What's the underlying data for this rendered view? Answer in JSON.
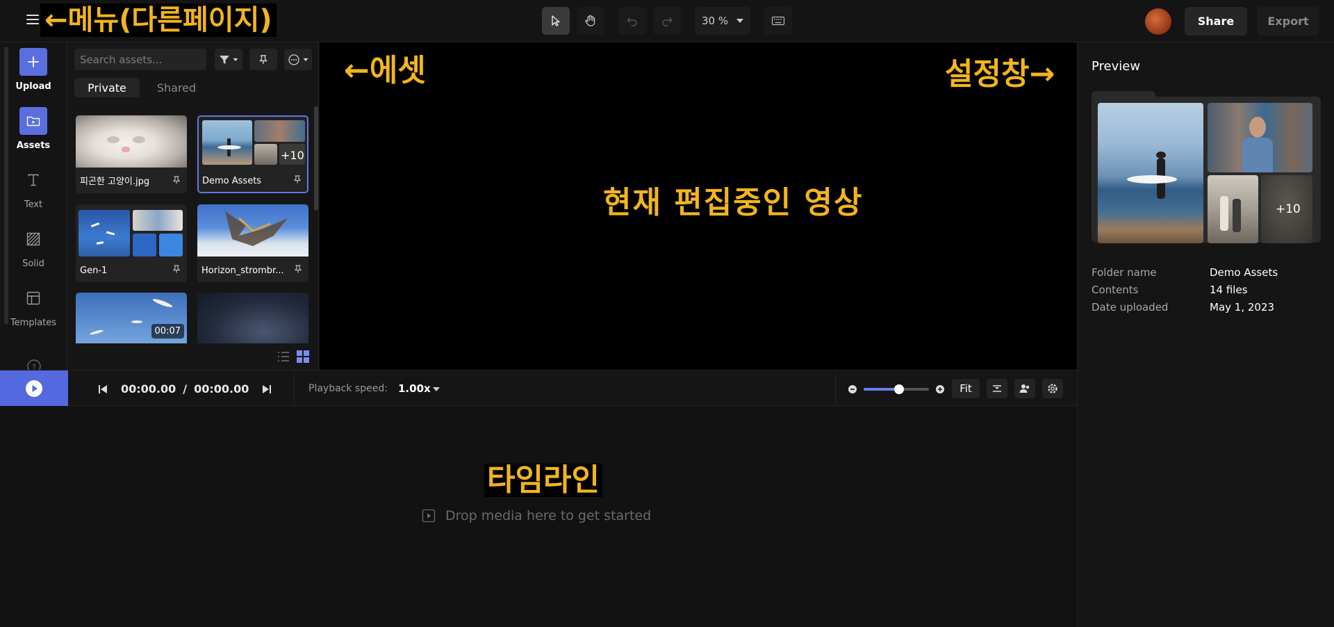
{
  "topbar": {
    "menu_annotation": "←메뉴(다른페이지)",
    "zoom_value": "30 %",
    "share_label": "Share",
    "export_label": "Export"
  },
  "rail": {
    "items": [
      {
        "label": "Upload",
        "icon": "plus-icon"
      },
      {
        "label": "Assets",
        "icon": "folder-play-icon"
      },
      {
        "label": "Text",
        "icon": "text-icon"
      },
      {
        "label": "Solid",
        "icon": "hatched-square-icon"
      },
      {
        "label": "Templates",
        "icon": "layout-icon"
      }
    ]
  },
  "assets": {
    "search_placeholder": "Search assets...",
    "tabs": [
      "Private",
      "Shared"
    ],
    "cards": [
      {
        "name": "피곤한 고양이.jpg"
      },
      {
        "name": "Demo Assets",
        "badge": "+10"
      },
      {
        "name": "Gen-1"
      },
      {
        "name": "Horizon_strombr..."
      },
      {
        "badge": "00:07"
      },
      {}
    ]
  },
  "canvas": {
    "asset_annotation": "←에셋",
    "settings_annotation": "설정창→",
    "video_annotation": "현재 편집중인 영상"
  },
  "preview": {
    "title": "Preview",
    "badge": "+10",
    "meta": [
      {
        "key": "Folder name",
        "value": "Demo Assets"
      },
      {
        "key": "Contents",
        "value": "14 files"
      },
      {
        "key": "Date uploaded",
        "value": "May 1, 2023"
      }
    ]
  },
  "playback": {
    "current_time": "00:00.00",
    "separator": "/",
    "total_time": "00:00.00",
    "speed_label": "Playback speed:",
    "speed_value": "1.00x",
    "zoom_level": 0.54,
    "fit_label": "Fit"
  },
  "timeline": {
    "annotation": "타임라인",
    "drop_text": "Drop media here to get started"
  },
  "colors": {
    "accent": "#5468e0",
    "annotation": "#f2b51c",
    "background": "#121212"
  }
}
